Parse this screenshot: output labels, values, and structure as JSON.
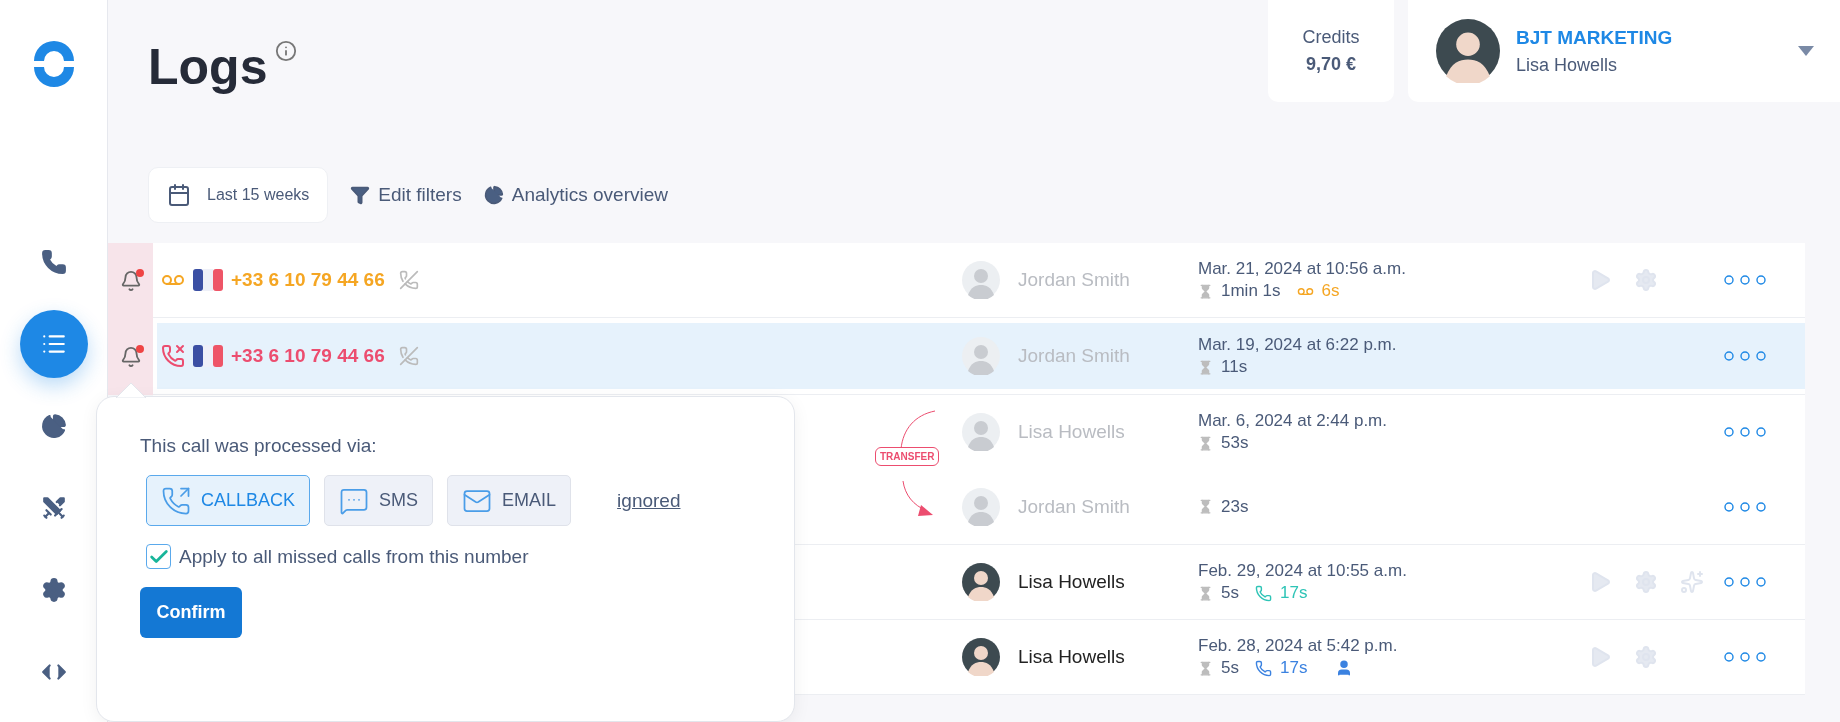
{
  "sidebar": {
    "items": [
      {
        "kind": "phone",
        "selected": false
      },
      {
        "kind": "logs",
        "selected": true
      },
      {
        "kind": "analytics",
        "selected": false
      },
      {
        "kind": "integrations",
        "selected": false
      },
      {
        "kind": "settings",
        "selected": false
      },
      {
        "kind": "developer",
        "selected": false
      }
    ]
  },
  "header": {
    "title": "Logs",
    "credits": {
      "label": "Credits",
      "value": "9,70 €"
    },
    "account": {
      "company": "BJT MARKETING",
      "user": "Lisa Howells"
    }
  },
  "filters": [
    {
      "kind": "date",
      "label": "Last 15 weeks"
    },
    {
      "kind": "filter",
      "label": "Edit filters"
    },
    {
      "kind": "analytics",
      "label": "Analytics overview"
    }
  ],
  "logs": [
    {
      "kind": "call",
      "selected": false,
      "alert": true,
      "type_icon": {
        "kind": "voicemail"
      },
      "number": "+33 6 10 79 44 66",
      "agent": "Jordan Smith",
      "agent_muted": true,
      "date": "Mar. 21, 2024 at 10:56 a.m.",
      "duration": "1min 1s",
      "extra": {
        "kind": "voicemail",
        "text": "6s",
        "color": "#f5a623"
      },
      "assigned": false,
      "actions": [
        {
          "kind": "play"
        },
        {
          "kind": "settings"
        }
      ]
    },
    {
      "kind": "call",
      "selected": true,
      "alert": true,
      "type_icon": {
        "kind": "missed"
      },
      "number": "+33 6 10 79 44 66",
      "agent": "Jordan Smith",
      "agent_muted": true,
      "date": "Mar. 19, 2024 at 6:22 p.m.",
      "duration": "11s",
      "assigned": false
    },
    {
      "kind": "transfer",
      "selected": false,
      "label": "TRANSFER",
      "legs": [
        {
          "agent": "Lisa Howells",
          "agent_muted": true,
          "date": "Mar. 6, 2024 at 2:44 p.m.",
          "duration": "53s"
        },
        {
          "agent": "Jordan Smith",
          "agent_muted": true,
          "duration": "23s"
        }
      ]
    },
    {
      "kind": "call",
      "selected": false,
      "agent": "Lisa Howells",
      "agent_muted": false,
      "date": "Feb. 29, 2024 at 10:55 a.m.",
      "duration": "5s",
      "extra": {
        "kind": "callback",
        "text": "17s",
        "color": "#2ec4b6"
      },
      "assigned": false,
      "actions": [
        {
          "kind": "play"
        },
        {
          "kind": "settings"
        },
        {
          "kind": "ai"
        }
      ]
    },
    {
      "kind": "call",
      "selected": false,
      "agent": "Lisa Howells",
      "agent_muted": false,
      "date": "Feb. 28, 2024 at 5:42 p.m.",
      "duration": "5s",
      "extra": {
        "kind": "callback",
        "text": "17s",
        "color": "#3b82e0"
      },
      "assigned": true,
      "actions": [
        {
          "kind": "play"
        },
        {
          "kind": "settings"
        }
      ]
    }
  ],
  "popover": {
    "prompt": "This call was processed via:",
    "options": [
      {
        "kind": "callback",
        "label": "CALLBACK",
        "selected": true
      },
      {
        "kind": "sms",
        "label": "SMS",
        "selected": false
      },
      {
        "kind": "email",
        "label": "EMAIL",
        "selected": false
      }
    ],
    "ignore_link": "ignored",
    "apply_all": {
      "label": "Apply to all missed calls from this number",
      "checked": true
    },
    "confirm": "Confirm"
  }
}
